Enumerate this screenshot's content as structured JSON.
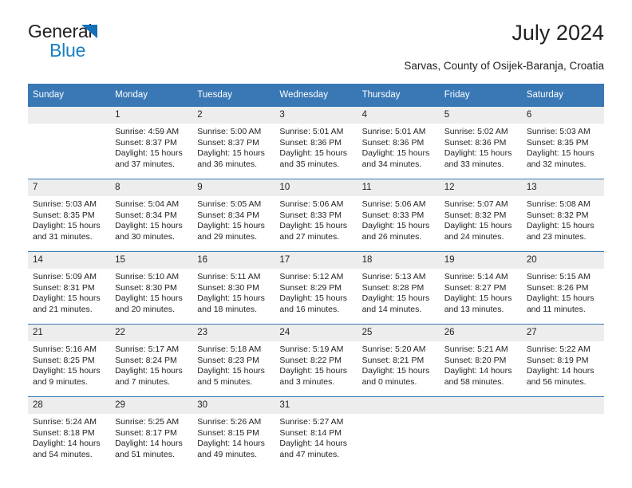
{
  "brand": {
    "line1": "General",
    "line2": "Blue",
    "accent_color": "#1a7fc1",
    "triangle_color": "#136fb7"
  },
  "header": {
    "title": "July 2024",
    "subtitle": "Sarvas, County of Osijek-Baranja, Croatia",
    "header_bg": "#3978b5",
    "daynum_bg": "#ededed"
  },
  "weekdays": [
    "Sunday",
    "Monday",
    "Tuesday",
    "Wednesday",
    "Thursday",
    "Friday",
    "Saturday"
  ],
  "labels": {
    "sunrise_prefix": "Sunrise:",
    "sunset_prefix": "Sunset:",
    "daylight_prefix": "Daylight:"
  },
  "weeks": [
    [
      {
        "day": "",
        "blank": true,
        "l1": "",
        "l2": "",
        "l3": "",
        "l4": ""
      },
      {
        "day": "1",
        "l1": "Sunrise: 4:59 AM",
        "l2": "Sunset: 8:37 PM",
        "l3": "Daylight: 15 hours",
        "l4": "and 37 minutes."
      },
      {
        "day": "2",
        "l1": "Sunrise: 5:00 AM",
        "l2": "Sunset: 8:37 PM",
        "l3": "Daylight: 15 hours",
        "l4": "and 36 minutes."
      },
      {
        "day": "3",
        "l1": "Sunrise: 5:01 AM",
        "l2": "Sunset: 8:36 PM",
        "l3": "Daylight: 15 hours",
        "l4": "and 35 minutes."
      },
      {
        "day": "4",
        "l1": "Sunrise: 5:01 AM",
        "l2": "Sunset: 8:36 PM",
        "l3": "Daylight: 15 hours",
        "l4": "and 34 minutes."
      },
      {
        "day": "5",
        "l1": "Sunrise: 5:02 AM",
        "l2": "Sunset: 8:36 PM",
        "l3": "Daylight: 15 hours",
        "l4": "and 33 minutes."
      },
      {
        "day": "6",
        "l1": "Sunrise: 5:03 AM",
        "l2": "Sunset: 8:35 PM",
        "l3": "Daylight: 15 hours",
        "l4": "and 32 minutes."
      }
    ],
    [
      {
        "day": "7",
        "l1": "Sunrise: 5:03 AM",
        "l2": "Sunset: 8:35 PM",
        "l3": "Daylight: 15 hours",
        "l4": "and 31 minutes."
      },
      {
        "day": "8",
        "l1": "Sunrise: 5:04 AM",
        "l2": "Sunset: 8:34 PM",
        "l3": "Daylight: 15 hours",
        "l4": "and 30 minutes."
      },
      {
        "day": "9",
        "l1": "Sunrise: 5:05 AM",
        "l2": "Sunset: 8:34 PM",
        "l3": "Daylight: 15 hours",
        "l4": "and 29 minutes."
      },
      {
        "day": "10",
        "l1": "Sunrise: 5:06 AM",
        "l2": "Sunset: 8:33 PM",
        "l3": "Daylight: 15 hours",
        "l4": "and 27 minutes."
      },
      {
        "day": "11",
        "l1": "Sunrise: 5:06 AM",
        "l2": "Sunset: 8:33 PM",
        "l3": "Daylight: 15 hours",
        "l4": "and 26 minutes."
      },
      {
        "day": "12",
        "l1": "Sunrise: 5:07 AM",
        "l2": "Sunset: 8:32 PM",
        "l3": "Daylight: 15 hours",
        "l4": "and 24 minutes."
      },
      {
        "day": "13",
        "l1": "Sunrise: 5:08 AM",
        "l2": "Sunset: 8:32 PM",
        "l3": "Daylight: 15 hours",
        "l4": "and 23 minutes."
      }
    ],
    [
      {
        "day": "14",
        "l1": "Sunrise: 5:09 AM",
        "l2": "Sunset: 8:31 PM",
        "l3": "Daylight: 15 hours",
        "l4": "and 21 minutes."
      },
      {
        "day": "15",
        "l1": "Sunrise: 5:10 AM",
        "l2": "Sunset: 8:30 PM",
        "l3": "Daylight: 15 hours",
        "l4": "and 20 minutes."
      },
      {
        "day": "16",
        "l1": "Sunrise: 5:11 AM",
        "l2": "Sunset: 8:30 PM",
        "l3": "Daylight: 15 hours",
        "l4": "and 18 minutes."
      },
      {
        "day": "17",
        "l1": "Sunrise: 5:12 AM",
        "l2": "Sunset: 8:29 PM",
        "l3": "Daylight: 15 hours",
        "l4": "and 16 minutes."
      },
      {
        "day": "18",
        "l1": "Sunrise: 5:13 AM",
        "l2": "Sunset: 8:28 PM",
        "l3": "Daylight: 15 hours",
        "l4": "and 14 minutes."
      },
      {
        "day": "19",
        "l1": "Sunrise: 5:14 AM",
        "l2": "Sunset: 8:27 PM",
        "l3": "Daylight: 15 hours",
        "l4": "and 13 minutes."
      },
      {
        "day": "20",
        "l1": "Sunrise: 5:15 AM",
        "l2": "Sunset: 8:26 PM",
        "l3": "Daylight: 15 hours",
        "l4": "and 11 minutes."
      }
    ],
    [
      {
        "day": "21",
        "l1": "Sunrise: 5:16 AM",
        "l2": "Sunset: 8:25 PM",
        "l3": "Daylight: 15 hours",
        "l4": "and 9 minutes."
      },
      {
        "day": "22",
        "l1": "Sunrise: 5:17 AM",
        "l2": "Sunset: 8:24 PM",
        "l3": "Daylight: 15 hours",
        "l4": "and 7 minutes."
      },
      {
        "day": "23",
        "l1": "Sunrise: 5:18 AM",
        "l2": "Sunset: 8:23 PM",
        "l3": "Daylight: 15 hours",
        "l4": "and 5 minutes."
      },
      {
        "day": "24",
        "l1": "Sunrise: 5:19 AM",
        "l2": "Sunset: 8:22 PM",
        "l3": "Daylight: 15 hours",
        "l4": "and 3 minutes."
      },
      {
        "day": "25",
        "l1": "Sunrise: 5:20 AM",
        "l2": "Sunset: 8:21 PM",
        "l3": "Daylight: 15 hours",
        "l4": "and 0 minutes."
      },
      {
        "day": "26",
        "l1": "Sunrise: 5:21 AM",
        "l2": "Sunset: 8:20 PM",
        "l3": "Daylight: 14 hours",
        "l4": "and 58 minutes."
      },
      {
        "day": "27",
        "l1": "Sunrise: 5:22 AM",
        "l2": "Sunset: 8:19 PM",
        "l3": "Daylight: 14 hours",
        "l4": "and 56 minutes."
      }
    ],
    [
      {
        "day": "28",
        "l1": "Sunrise: 5:24 AM",
        "l2": "Sunset: 8:18 PM",
        "l3": "Daylight: 14 hours",
        "l4": "and 54 minutes."
      },
      {
        "day": "29",
        "l1": "Sunrise: 5:25 AM",
        "l2": "Sunset: 8:17 PM",
        "l3": "Daylight: 14 hours",
        "l4": "and 51 minutes."
      },
      {
        "day": "30",
        "l1": "Sunrise: 5:26 AM",
        "l2": "Sunset: 8:15 PM",
        "l3": "Daylight: 14 hours",
        "l4": "and 49 minutes."
      },
      {
        "day": "31",
        "l1": "Sunrise: 5:27 AM",
        "l2": "Sunset: 8:14 PM",
        "l3": "Daylight: 14 hours",
        "l4": "and 47 minutes."
      },
      {
        "day": "",
        "blank": true,
        "l1": "",
        "l2": "",
        "l3": "",
        "l4": ""
      },
      {
        "day": "",
        "blank": true,
        "l1": "",
        "l2": "",
        "l3": "",
        "l4": ""
      },
      {
        "day": "",
        "blank": true,
        "l1": "",
        "l2": "",
        "l3": "",
        "l4": ""
      }
    ]
  ]
}
